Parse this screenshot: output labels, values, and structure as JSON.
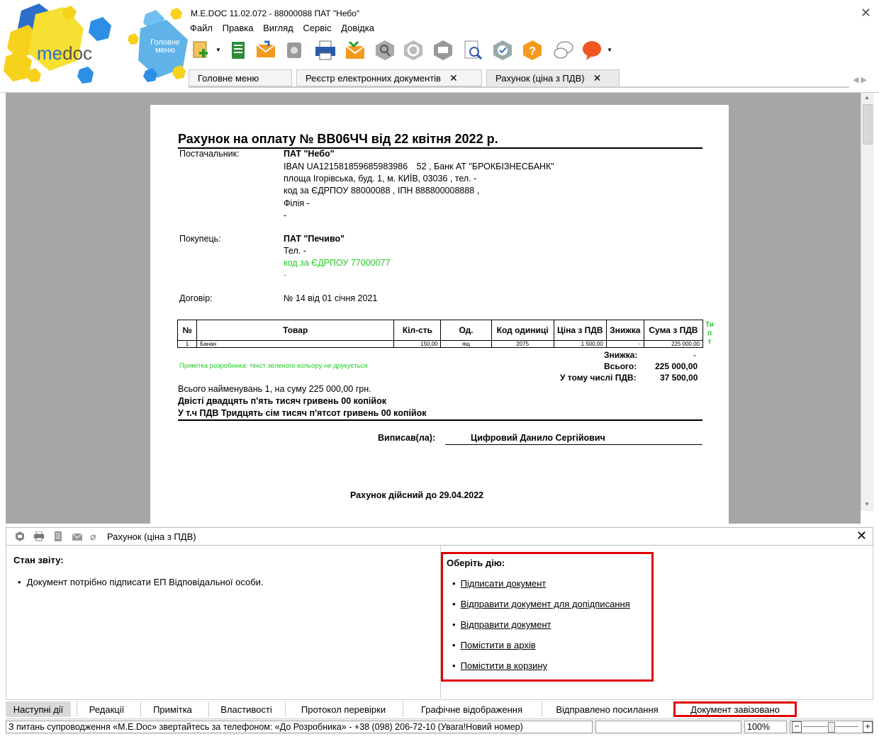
{
  "window": {
    "title": "M.E.DOC 11.02.072  - 88000088 ПАТ \"Небо\"",
    "close": "✕"
  },
  "logo": {
    "text_me": "me",
    "text_doc": "doc",
    "home_line1": "Головне",
    "home_line2": "меню"
  },
  "menu": [
    "Файл",
    "Правка",
    "Вигляд",
    "Сервіс",
    "Довідка"
  ],
  "tabs": [
    {
      "label": "Головне меню",
      "closable": false
    },
    {
      "label": "Реєстр електронних документів",
      "closable": true
    },
    {
      "label": "Рахунок (ціна з ПДВ)",
      "closable": true
    }
  ],
  "tab_close": "✕",
  "tab_arrows": "◀ ▶",
  "document": {
    "title": "Рахунок на оплату № ВВ06ЧЧ від 22 квітня 2022 р.",
    "supplier_label": "Постачальник:",
    "supplier_lines": [
      "ПАТ \"Небо\"",
      "IBAN UA121581859685983986 52   , Банк АТ \"БРОКБІЗНЕСБАНК\"",
      "площа Ігорівська, буд. 1, м. КИЇВ, 03036 , тел. -",
      "код за ЄДРПОУ 88000088 , ІПН  888800008888 ,",
      "Філія -",
      "-"
    ],
    "buyer_label": "Покупець:",
    "buyer_lines": [
      "ПАТ \"Печиво\"",
      "Тел. -",
      "код за ЄДРПОУ 77000077",
      "-"
    ],
    "contract_label": "Договір:",
    "contract_value": "№ 14 від 01 січня 2021",
    "table_headers": [
      "№",
      "Товар",
      "Кіл-сть",
      "Од.",
      "Код одиниці",
      "Ціна з ПДВ",
      "Знижка",
      "Сума з ПДВ"
    ],
    "table_rows": [
      [
        "1",
        "Банан",
        "150,00",
        "ящ",
        "2075",
        "1 500,00",
        "-",
        "225 000,00"
      ]
    ],
    "side_label": [
      "Ти",
      "п",
      "т"
    ],
    "discount_label": "Знижка:",
    "discount_value": "-",
    "total_label": "Всього:",
    "total_value": "225 000,00",
    "vat_label": "У тому числі ПДВ:",
    "vat_value": "37 500,00",
    "dev_note": "Примітка розробника: текст зеленого кольору не друкується",
    "items_summary": "Всього найменувань  1, на суму 225 000,00  грн.",
    "sum_words": "Двісті двадцять  п'ять тисяч гривень 00 копійок",
    "vat_words": "У т.ч ПДВ Тридцять сім тисяч п'ятсот гривень 00 копійок",
    "issued_label": "Виписав(ла):",
    "issued_name": "Цифровий Данило Сергійович",
    "valid_until": "Рахунок дійсний до  29.04.2022"
  },
  "panel": {
    "title": "Рахунок (ціна з ПДВ)",
    "close": "✕",
    "status_heading": "Стан звіту:",
    "status_items": [
      "Документ потрібно підписати ЕП Відповідальної особи."
    ],
    "actions_heading": "Оберіть дію:",
    "actions": [
      "Підписати документ",
      "Відправити документ для допідписання",
      "Відправити документ",
      "Помістити в архів",
      "Помістити в корзину"
    ]
  },
  "bottom_tabs": [
    "Наступні дії",
    "Редакції",
    "Примітка",
    "Властивості",
    "Протокол перевірки",
    "Графічне відображення",
    "Відправлено посилання",
    "Документ завізовано"
  ],
  "statusbar": {
    "message": "З питань супроводження «M.E.Doc» звертайтесь за телефоном: «До Розробника» - +38 (098) 206-72-10 (Увага!Новий номер)",
    "zoom": "100%",
    "zoom_minus": "−",
    "zoom_plus": "+"
  },
  "colors": {
    "highlight": "#e00000",
    "green_text": "#22cc22",
    "doc_bg": "#a6a6a6"
  }
}
